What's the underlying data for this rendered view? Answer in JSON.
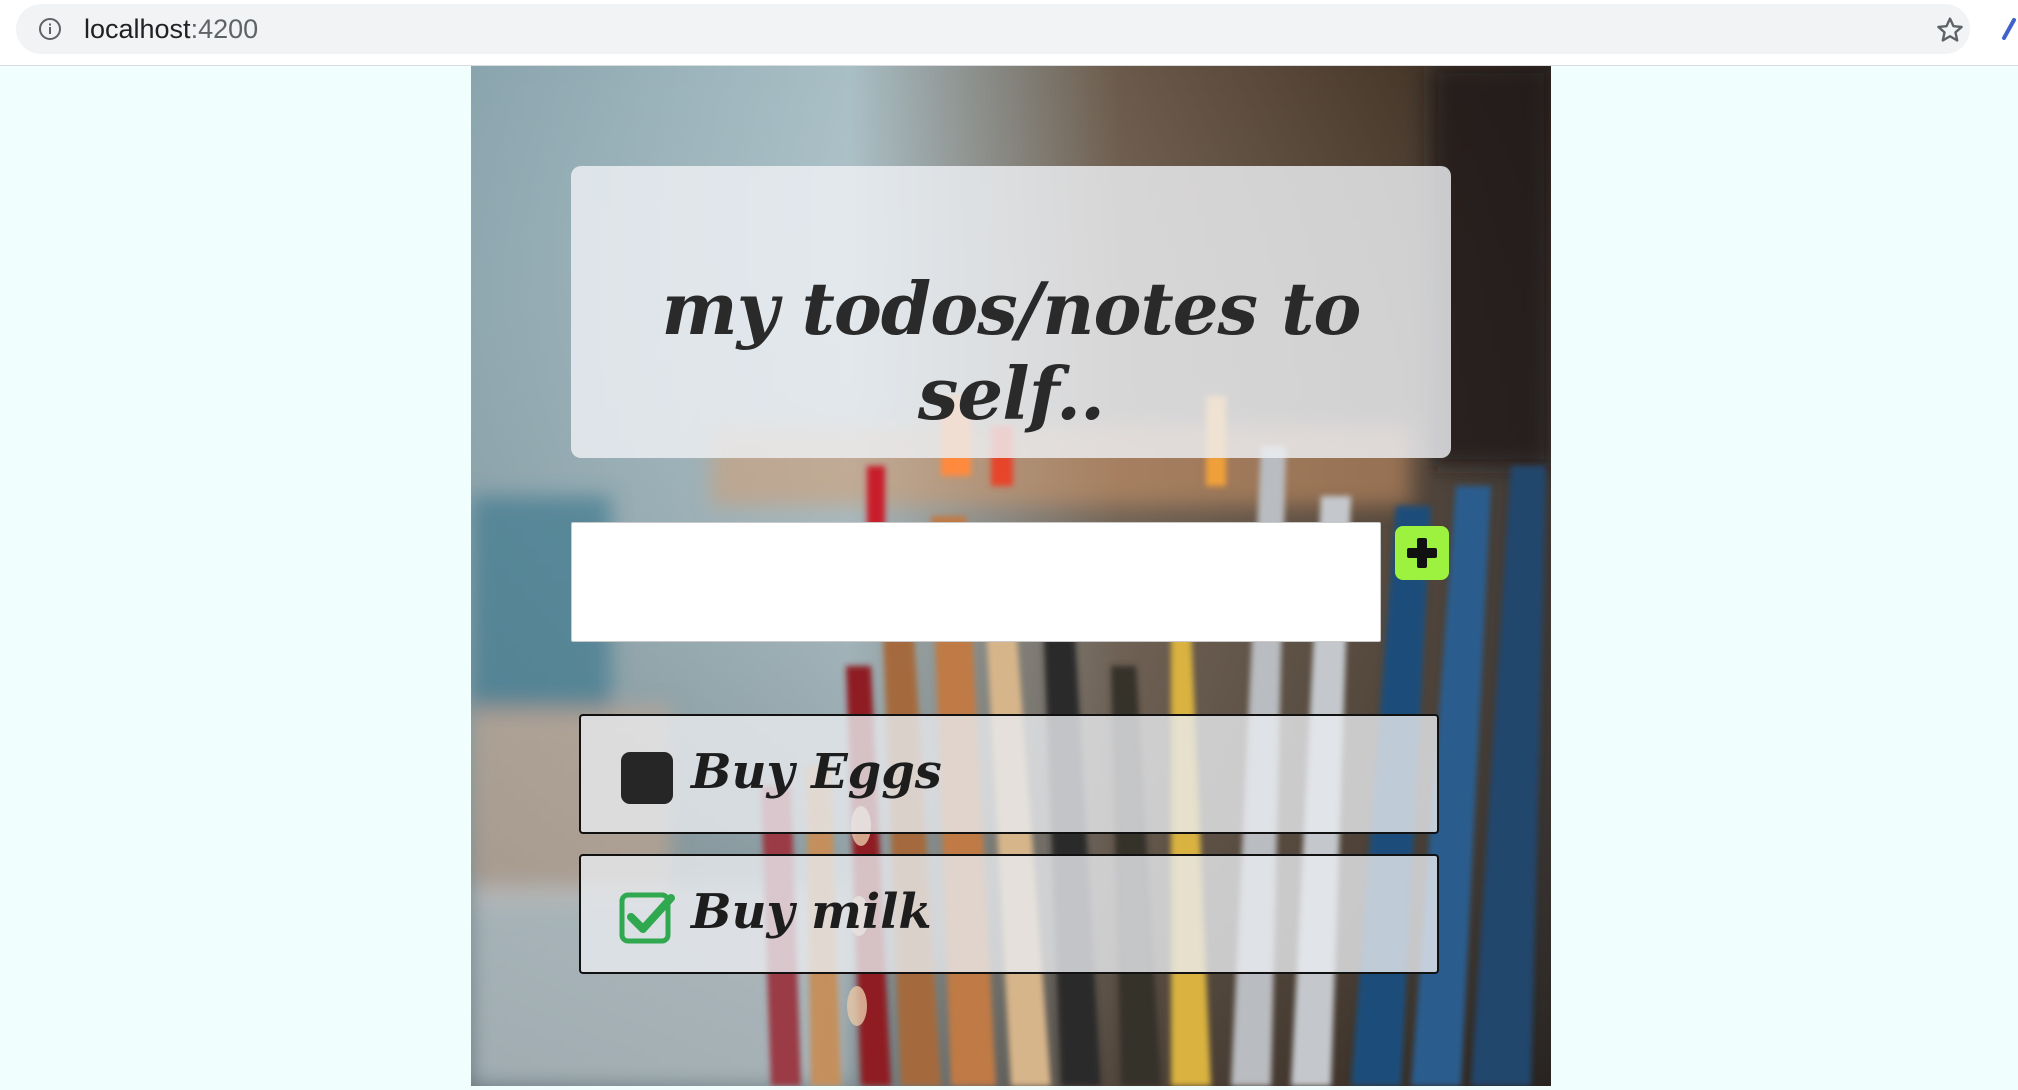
{
  "browser": {
    "url_host": "localhost",
    "url_port": ":4200",
    "icons": [
      "info-icon",
      "star-icon",
      "extension-icon"
    ]
  },
  "app": {
    "title": "my todos/notes to self..",
    "input": {
      "value": "",
      "placeholder": ""
    },
    "add_button_icon": "plus-icon",
    "accent_color": "#9cf23f",
    "todos": [
      {
        "label": "Buy Eggs",
        "done": false
      },
      {
        "label": "Buy milk",
        "done": true
      }
    ]
  }
}
